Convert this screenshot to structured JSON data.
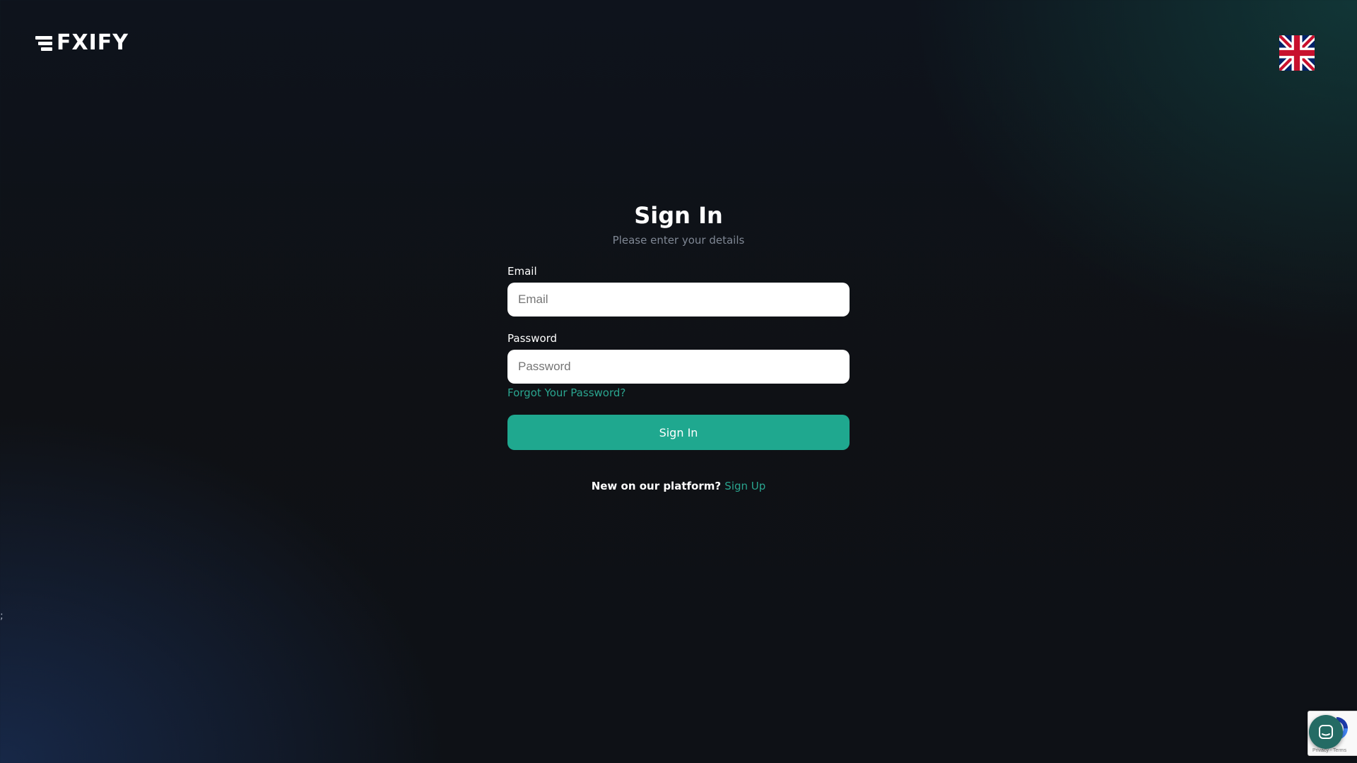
{
  "brand": {
    "name": "FXIFY"
  },
  "language": {
    "current_icon": "uk-flag-icon"
  },
  "signin": {
    "title": "Sign In",
    "subtitle": "Please enter your details",
    "email_label": "Email",
    "email_placeholder": "Email",
    "email_value": "",
    "password_label": "Password",
    "password_placeholder": "Password",
    "password_value": "",
    "forgot_link": "Forgot Your Password?",
    "submit_label": "Sign In",
    "signup_prompt": "New on our platform?",
    "signup_link": "Sign Up"
  },
  "recaptcha": {
    "terms": "Privacy - Terms"
  },
  "chat": {
    "icon": "chat-bubble-icon"
  },
  "colors": {
    "accent": "#1fa88f",
    "link": "#2aa58f",
    "background": "#0f1115"
  }
}
